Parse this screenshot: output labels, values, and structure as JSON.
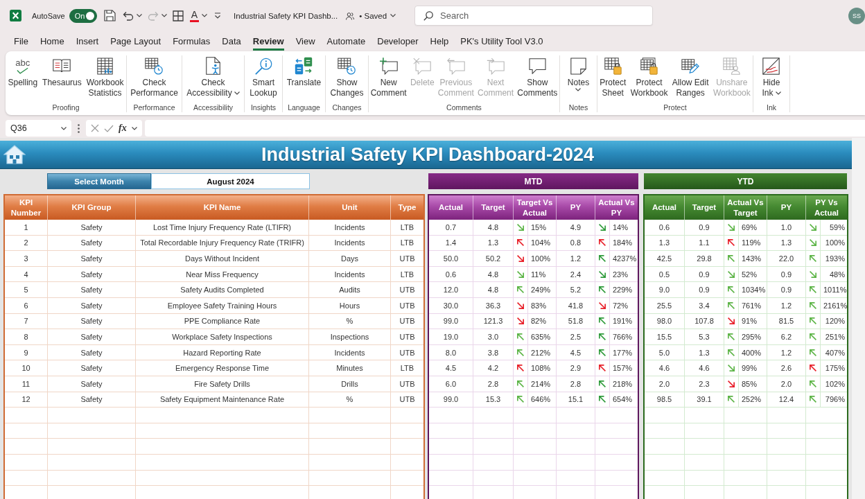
{
  "title_bar": {
    "autosave": {
      "label": "AutoSave",
      "state": "On",
      "on": true
    },
    "font_color_glyph": "A",
    "document_title": "Industrial Safety KPI Dashb...",
    "save_status": "• Saved",
    "search": {
      "placeholder": "Search"
    },
    "avatar": "SS"
  },
  "menu_tabs": [
    {
      "label": "File",
      "selected": false
    },
    {
      "label": "Home",
      "selected": false
    },
    {
      "label": "Insert",
      "selected": false
    },
    {
      "label": "Page Layout",
      "selected": false
    },
    {
      "label": "Formulas",
      "selected": false
    },
    {
      "label": "Data",
      "selected": false
    },
    {
      "label": "Review",
      "selected": true
    },
    {
      "label": "View",
      "selected": false
    },
    {
      "label": "Automate",
      "selected": false
    },
    {
      "label": "Developer",
      "selected": false
    },
    {
      "label": "Help",
      "selected": false
    },
    {
      "label": "PK's Utility Tool V3.0",
      "selected": false
    }
  ],
  "ribbon": {
    "groups": [
      {
        "label": "Proofing",
        "commands": [
          {
            "label": "Spelling",
            "glyph": "abc",
            "disabled": false,
            "dropdown": false
          },
          {
            "label": "Thesaurus",
            "disabled": false,
            "dropdown": false
          },
          {
            "label": "Workbook\nStatistics",
            "disabled": false,
            "dropdown": false
          }
        ]
      },
      {
        "label": "Performance",
        "commands": [
          {
            "label": "Check\nPerformance",
            "disabled": false,
            "dropdown": false
          }
        ]
      },
      {
        "label": "Accessibility",
        "commands": [
          {
            "label": "Check\nAccessibility",
            "disabled": false,
            "dropdown": true
          }
        ]
      },
      {
        "label": "Insights",
        "commands": [
          {
            "label": "Smart\nLookup",
            "disabled": false,
            "dropdown": false
          }
        ]
      },
      {
        "label": "Language",
        "commands": [
          {
            "label": "Translate",
            "disabled": false,
            "dropdown": false
          }
        ]
      },
      {
        "label": "Changes",
        "commands": [
          {
            "label": "Show\nChanges",
            "disabled": false,
            "dropdown": false
          }
        ]
      },
      {
        "label": "Comments",
        "commands": [
          {
            "label": "New\nComment",
            "disabled": false,
            "dropdown": false
          },
          {
            "label": "Delete",
            "disabled": true,
            "dropdown": false
          },
          {
            "label": "Previous\nComment",
            "disabled": true,
            "dropdown": false
          },
          {
            "label": "Next\nComment",
            "disabled": true,
            "dropdown": false
          },
          {
            "label": "Show\nComments",
            "disabled": false,
            "dropdown": false
          }
        ]
      },
      {
        "label": "Notes",
        "commands": [
          {
            "label": "Notes",
            "disabled": false,
            "dropdown": true
          }
        ]
      },
      {
        "label": "Protect",
        "commands": [
          {
            "label": "Protect\nSheet",
            "disabled": false,
            "dropdown": false
          },
          {
            "label": "Protect\nWorkbook",
            "disabled": false,
            "dropdown": false
          },
          {
            "label": "Allow Edit\nRanges",
            "disabled": false,
            "dropdown": false
          },
          {
            "label": "Unshare\nWorkbook",
            "disabled": true,
            "dropdown": false
          }
        ]
      },
      {
        "label": "Ink",
        "commands": [
          {
            "label": "Hide\nInk",
            "disabled": false,
            "dropdown": true
          }
        ]
      }
    ]
  },
  "formula_bar": {
    "name_box": "Q36",
    "function_glyph": "fx"
  },
  "dashboard": {
    "title": "Industrial Safety KPI Dashboard-2024",
    "month_selector": {
      "label": "Select Month",
      "value": "August 2024"
    },
    "kpi_table": {
      "columns": [
        "KPI\nNumber",
        "KPI Group",
        "KPI Name",
        "Unit",
        "Type"
      ],
      "rows": [
        {
          "number": "1",
          "group": "Safety",
          "name": "Lost Time Injury Frequency Rate (LTIFR)",
          "unit": "Incidents",
          "type": "LTB"
        },
        {
          "number": "2",
          "group": "Safety",
          "name": "Total Recordable Injury Frequency Rate (TRIFR)",
          "unit": "Incidents",
          "type": "LTB"
        },
        {
          "number": "3",
          "group": "Safety",
          "name": "Days Without Incident",
          "unit": "Days",
          "type": "UTB"
        },
        {
          "number": "4",
          "group": "Safety",
          "name": "Near Miss Frequency",
          "unit": "Incidents",
          "type": "LTB"
        },
        {
          "number": "5",
          "group": "Safety",
          "name": "Safety Audits Completed",
          "unit": "Audits",
          "type": "UTB"
        },
        {
          "number": "6",
          "group": "Safety",
          "name": "Employee Safety Training Hours",
          "unit": "Hours",
          "type": "UTB"
        },
        {
          "number": "7",
          "group": "Safety",
          "name": "PPE Compliance Rate",
          "unit": "%",
          "type": "UTB"
        },
        {
          "number": "8",
          "group": "Safety",
          "name": "Workplace Safety Inspections",
          "unit": "Inspections",
          "type": "UTB"
        },
        {
          "number": "9",
          "group": "Safety",
          "name": "Hazard Reporting Rate",
          "unit": "Incidents",
          "type": "UTB"
        },
        {
          "number": "10",
          "group": "Safety",
          "name": "Emergency Response Time",
          "unit": "Minutes",
          "type": "LTB"
        },
        {
          "number": "11",
          "group": "Safety",
          "name": "Fire Safety Drills",
          "unit": "Drills",
          "type": "UTB"
        },
        {
          "number": "12",
          "group": "Safety",
          "name": "Safety Equipment Maintenance Rate",
          "unit": "%",
          "type": "UTB"
        }
      ]
    },
    "mtd": {
      "title": "MTD",
      "columns": [
        "Actual",
        "Target",
        "Target Vs\nActual",
        "PY",
        "Actual Vs\nPY"
      ],
      "rows": [
        {
          "actual": "0.7",
          "target": "4.8",
          "target_vs_actual": {
            "kind": "down",
            "color": "#5cb446",
            "value": "15%"
          },
          "py": "4.9",
          "actual_vs_py": {
            "kind": "down",
            "color": "#2e9a3a",
            "value": "14%"
          }
        },
        {
          "actual": "1.4",
          "target": "1.3",
          "target_vs_actual": {
            "kind": "up",
            "color": "#e8202a",
            "value": "104%"
          },
          "py": "0.8",
          "actual_vs_py": {
            "kind": "up",
            "color": "#e8202a",
            "value": "184%"
          }
        },
        {
          "actual": "50.0",
          "target": "50.2",
          "target_vs_actual": {
            "kind": "down",
            "color": "#e8202a",
            "value": "100%"
          },
          "py": "1.2",
          "actual_vs_py": {
            "kind": "up",
            "color": "#2e9a3a",
            "value": "4237%"
          }
        },
        {
          "actual": "0.6",
          "target": "4.8",
          "target_vs_actual": {
            "kind": "down",
            "color": "#5cb446",
            "value": "11%"
          },
          "py": "2.4",
          "actual_vs_py": {
            "kind": "down",
            "color": "#2e9a3a",
            "value": "23%"
          }
        },
        {
          "actual": "12.0",
          "target": "4.8",
          "target_vs_actual": {
            "kind": "up",
            "color": "#5cb446",
            "value": "249%"
          },
          "py": "5.2",
          "actual_vs_py": {
            "kind": "up",
            "color": "#2e9a3a",
            "value": "229%"
          }
        },
        {
          "actual": "30.0",
          "target": "36.3",
          "target_vs_actual": {
            "kind": "down",
            "color": "#e8202a",
            "value": "83%"
          },
          "py": "41.8",
          "actual_vs_py": {
            "kind": "down",
            "color": "#e8202a",
            "value": "72%"
          }
        },
        {
          "actual": "99.0",
          "target": "121.3",
          "target_vs_actual": {
            "kind": "down",
            "color": "#e8202a",
            "value": "82%"
          },
          "py": "51.8",
          "actual_vs_py": {
            "kind": "up",
            "color": "#2e9a3a",
            "value": "191%"
          }
        },
        {
          "actual": "19.0",
          "target": "3.0",
          "target_vs_actual": {
            "kind": "up",
            "color": "#5cb446",
            "value": "635%"
          },
          "py": "2.5",
          "actual_vs_py": {
            "kind": "up",
            "color": "#2e9a3a",
            "value": "766%"
          }
        },
        {
          "actual": "8.0",
          "target": "3.8",
          "target_vs_actual": {
            "kind": "up",
            "color": "#5cb446",
            "value": "212%"
          },
          "py": "4.5",
          "actual_vs_py": {
            "kind": "up",
            "color": "#2e9a3a",
            "value": "177%"
          }
        },
        {
          "actual": "4.5",
          "target": "4.2",
          "target_vs_actual": {
            "kind": "up",
            "color": "#e8202a",
            "value": "108%"
          },
          "py": "2.9",
          "actual_vs_py": {
            "kind": "up",
            "color": "#e8202a",
            "value": "157%"
          }
        },
        {
          "actual": "6.0",
          "target": "2.8",
          "target_vs_actual": {
            "kind": "up",
            "color": "#5cb446",
            "value": "214%"
          },
          "py": "2.8",
          "actual_vs_py": {
            "kind": "up",
            "color": "#2e9a3a",
            "value": "218%"
          }
        },
        {
          "actual": "99.0",
          "target": "15.3",
          "target_vs_actual": {
            "kind": "up",
            "color": "#5cb446",
            "value": "646%"
          },
          "py": "15.1",
          "actual_vs_py": {
            "kind": "up",
            "color": "#2e9a3a",
            "value": "654%"
          }
        }
      ]
    },
    "ytd": {
      "title": "YTD",
      "columns": [
        "Actual",
        "Target",
        "Actual Vs\nTarget",
        "PY",
        "PY Vs\nActual"
      ],
      "rows": [
        {
          "actual": "0.6",
          "target": "0.9",
          "actual_vs_target": {
            "kind": "down",
            "color": "#5cb446",
            "value": "69%"
          },
          "py": "1.0",
          "py_vs_actual": {
            "kind": "down",
            "color": "#5cb446",
            "value": "59%"
          }
        },
        {
          "actual": "1.3",
          "target": "1.1",
          "actual_vs_target": {
            "kind": "up",
            "color": "#e8202a",
            "value": "119%"
          },
          "py": "1.3",
          "py_vs_actual": {
            "kind": "down",
            "color": "#5cb446",
            "value": "100%"
          }
        },
        {
          "actual": "42.5",
          "target": "29.8",
          "actual_vs_target": {
            "kind": "up",
            "color": "#5cb446",
            "value": "143%"
          },
          "py": "22.0",
          "py_vs_actual": {
            "kind": "up",
            "color": "#5cb446",
            "value": "193%"
          }
        },
        {
          "actual": "0.5",
          "target": "0.9",
          "actual_vs_target": {
            "kind": "down",
            "color": "#5cb446",
            "value": "52%"
          },
          "py": "0.9",
          "py_vs_actual": {
            "kind": "down",
            "color": "#5cb446",
            "value": "48%"
          }
        },
        {
          "actual": "9.0",
          "target": "0.9",
          "actual_vs_target": {
            "kind": "up",
            "color": "#5cb446",
            "value": "1034%"
          },
          "py": "0.9",
          "py_vs_actual": {
            "kind": "up",
            "color": "#5cb446",
            "value": "1011%"
          }
        },
        {
          "actual": "25.5",
          "target": "3.4",
          "actual_vs_target": {
            "kind": "up",
            "color": "#5cb446",
            "value": "761%"
          },
          "py": "1.2",
          "py_vs_actual": {
            "kind": "up",
            "color": "#5cb446",
            "value": "2161%"
          }
        },
        {
          "actual": "98.0",
          "target": "107.8",
          "actual_vs_target": {
            "kind": "down",
            "color": "#e8202a",
            "value": "91%"
          },
          "py": "81.5",
          "py_vs_actual": {
            "kind": "up",
            "color": "#5cb446",
            "value": "120%"
          }
        },
        {
          "actual": "15.5",
          "target": "5.3",
          "actual_vs_target": {
            "kind": "up",
            "color": "#5cb446",
            "value": "295%"
          },
          "py": "6.2",
          "py_vs_actual": {
            "kind": "up",
            "color": "#5cb446",
            "value": "251%"
          }
        },
        {
          "actual": "5.0",
          "target": "1.3",
          "actual_vs_target": {
            "kind": "up",
            "color": "#5cb446",
            "value": "400%"
          },
          "py": "1.2",
          "py_vs_actual": {
            "kind": "up",
            "color": "#5cb446",
            "value": "407%"
          }
        },
        {
          "actual": "4.6",
          "target": "4.6",
          "actual_vs_target": {
            "kind": "down",
            "color": "#5cb446",
            "value": "99%"
          },
          "py": "2.6",
          "py_vs_actual": {
            "kind": "up",
            "color": "#e8202a",
            "value": "175%"
          }
        },
        {
          "actual": "2.0",
          "target": "2.3",
          "actual_vs_target": {
            "kind": "down",
            "color": "#e8202a",
            "value": "85%"
          },
          "py": "2.0",
          "py_vs_actual": {
            "kind": "up",
            "color": "#5cb446",
            "value": "102%"
          }
        },
        {
          "actual": "98.5",
          "target": "39.1",
          "actual_vs_target": {
            "kind": "up",
            "color": "#5cb446",
            "value": "252%"
          },
          "py": "12.4",
          "py_vs_actual": {
            "kind": "up",
            "color": "#5cb446",
            "value": "796%"
          }
        }
      ]
    }
  }
}
